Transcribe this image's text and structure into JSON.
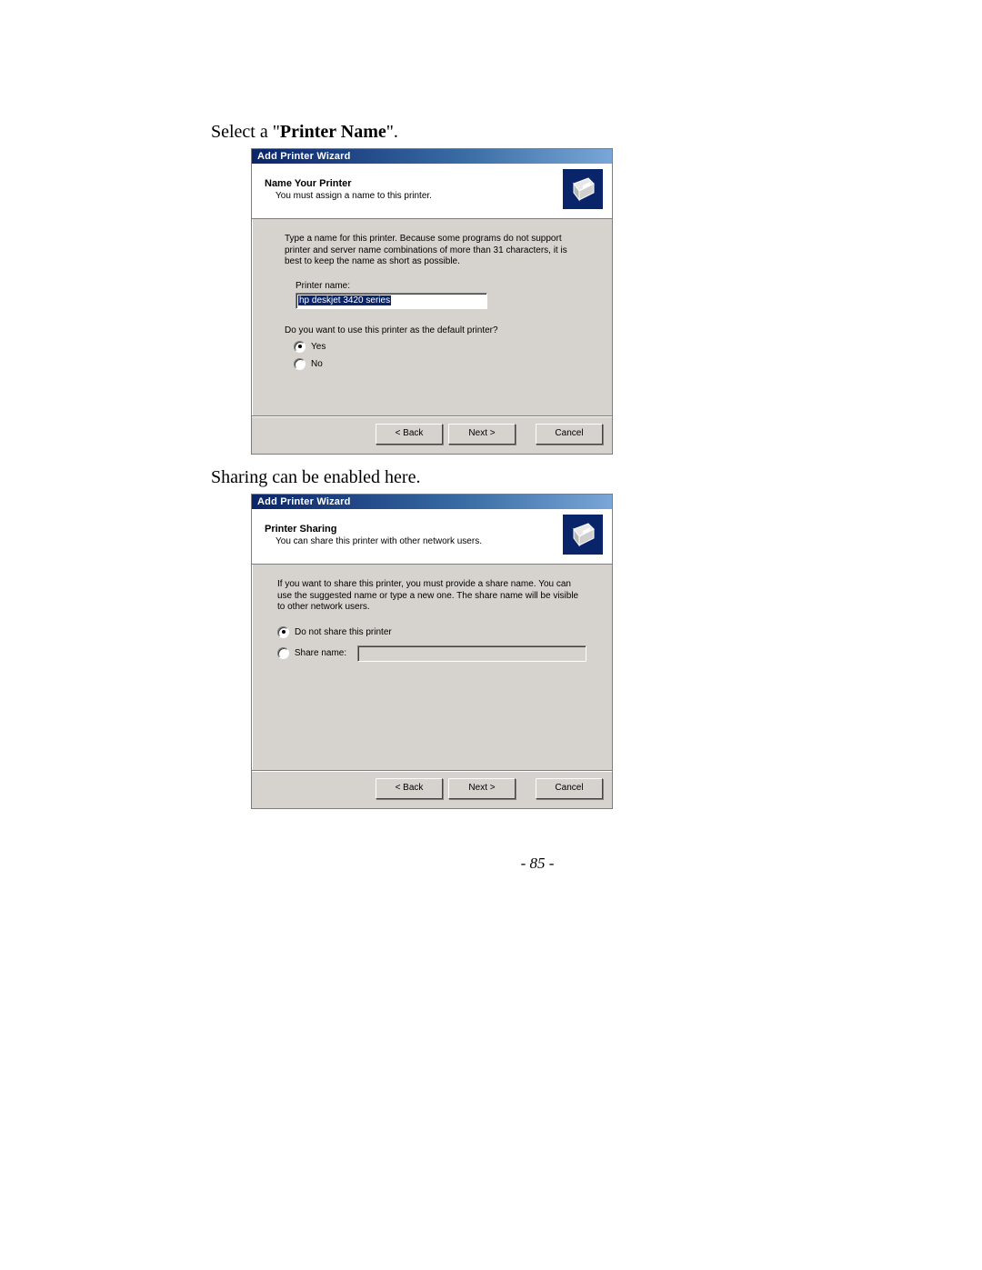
{
  "body": {
    "line1_pre": "Select a \"",
    "line1_bold": "Printer Name",
    "line1_post": "\".",
    "line2": "Sharing can be enabled here."
  },
  "wizard1": {
    "title": "Add Printer Wizard",
    "header_title": "Name Your Printer",
    "header_sub": "You must assign a name to this printer.",
    "para": "Type a name for this printer. Because some programs do not support printer and server name combinations of more than 31 characters, it is best to keep the name as short as possible.",
    "field_label": "Printer name:",
    "field_value": "hp deskjet 3420 series",
    "question": "Do you want to use this printer as the default printer?",
    "radio_yes": "Yes",
    "radio_no": "No",
    "btn_back": "< Back",
    "btn_next": "Next >",
    "btn_cancel": "Cancel"
  },
  "wizard2": {
    "title": "Add Printer Wizard",
    "header_title": "Printer Sharing",
    "header_sub": "You can share this printer with other network users.",
    "para": "If you want to share this printer, you must provide a share name. You can use the suggested name or type a new one. The share name will be visible to other network users.",
    "radio_noshare": "Do not share this printer",
    "radio_share": "Share name:",
    "share_value": "",
    "btn_back": "< Back",
    "btn_next": "Next >",
    "btn_cancel": "Cancel"
  },
  "page_number": "- 85 -"
}
